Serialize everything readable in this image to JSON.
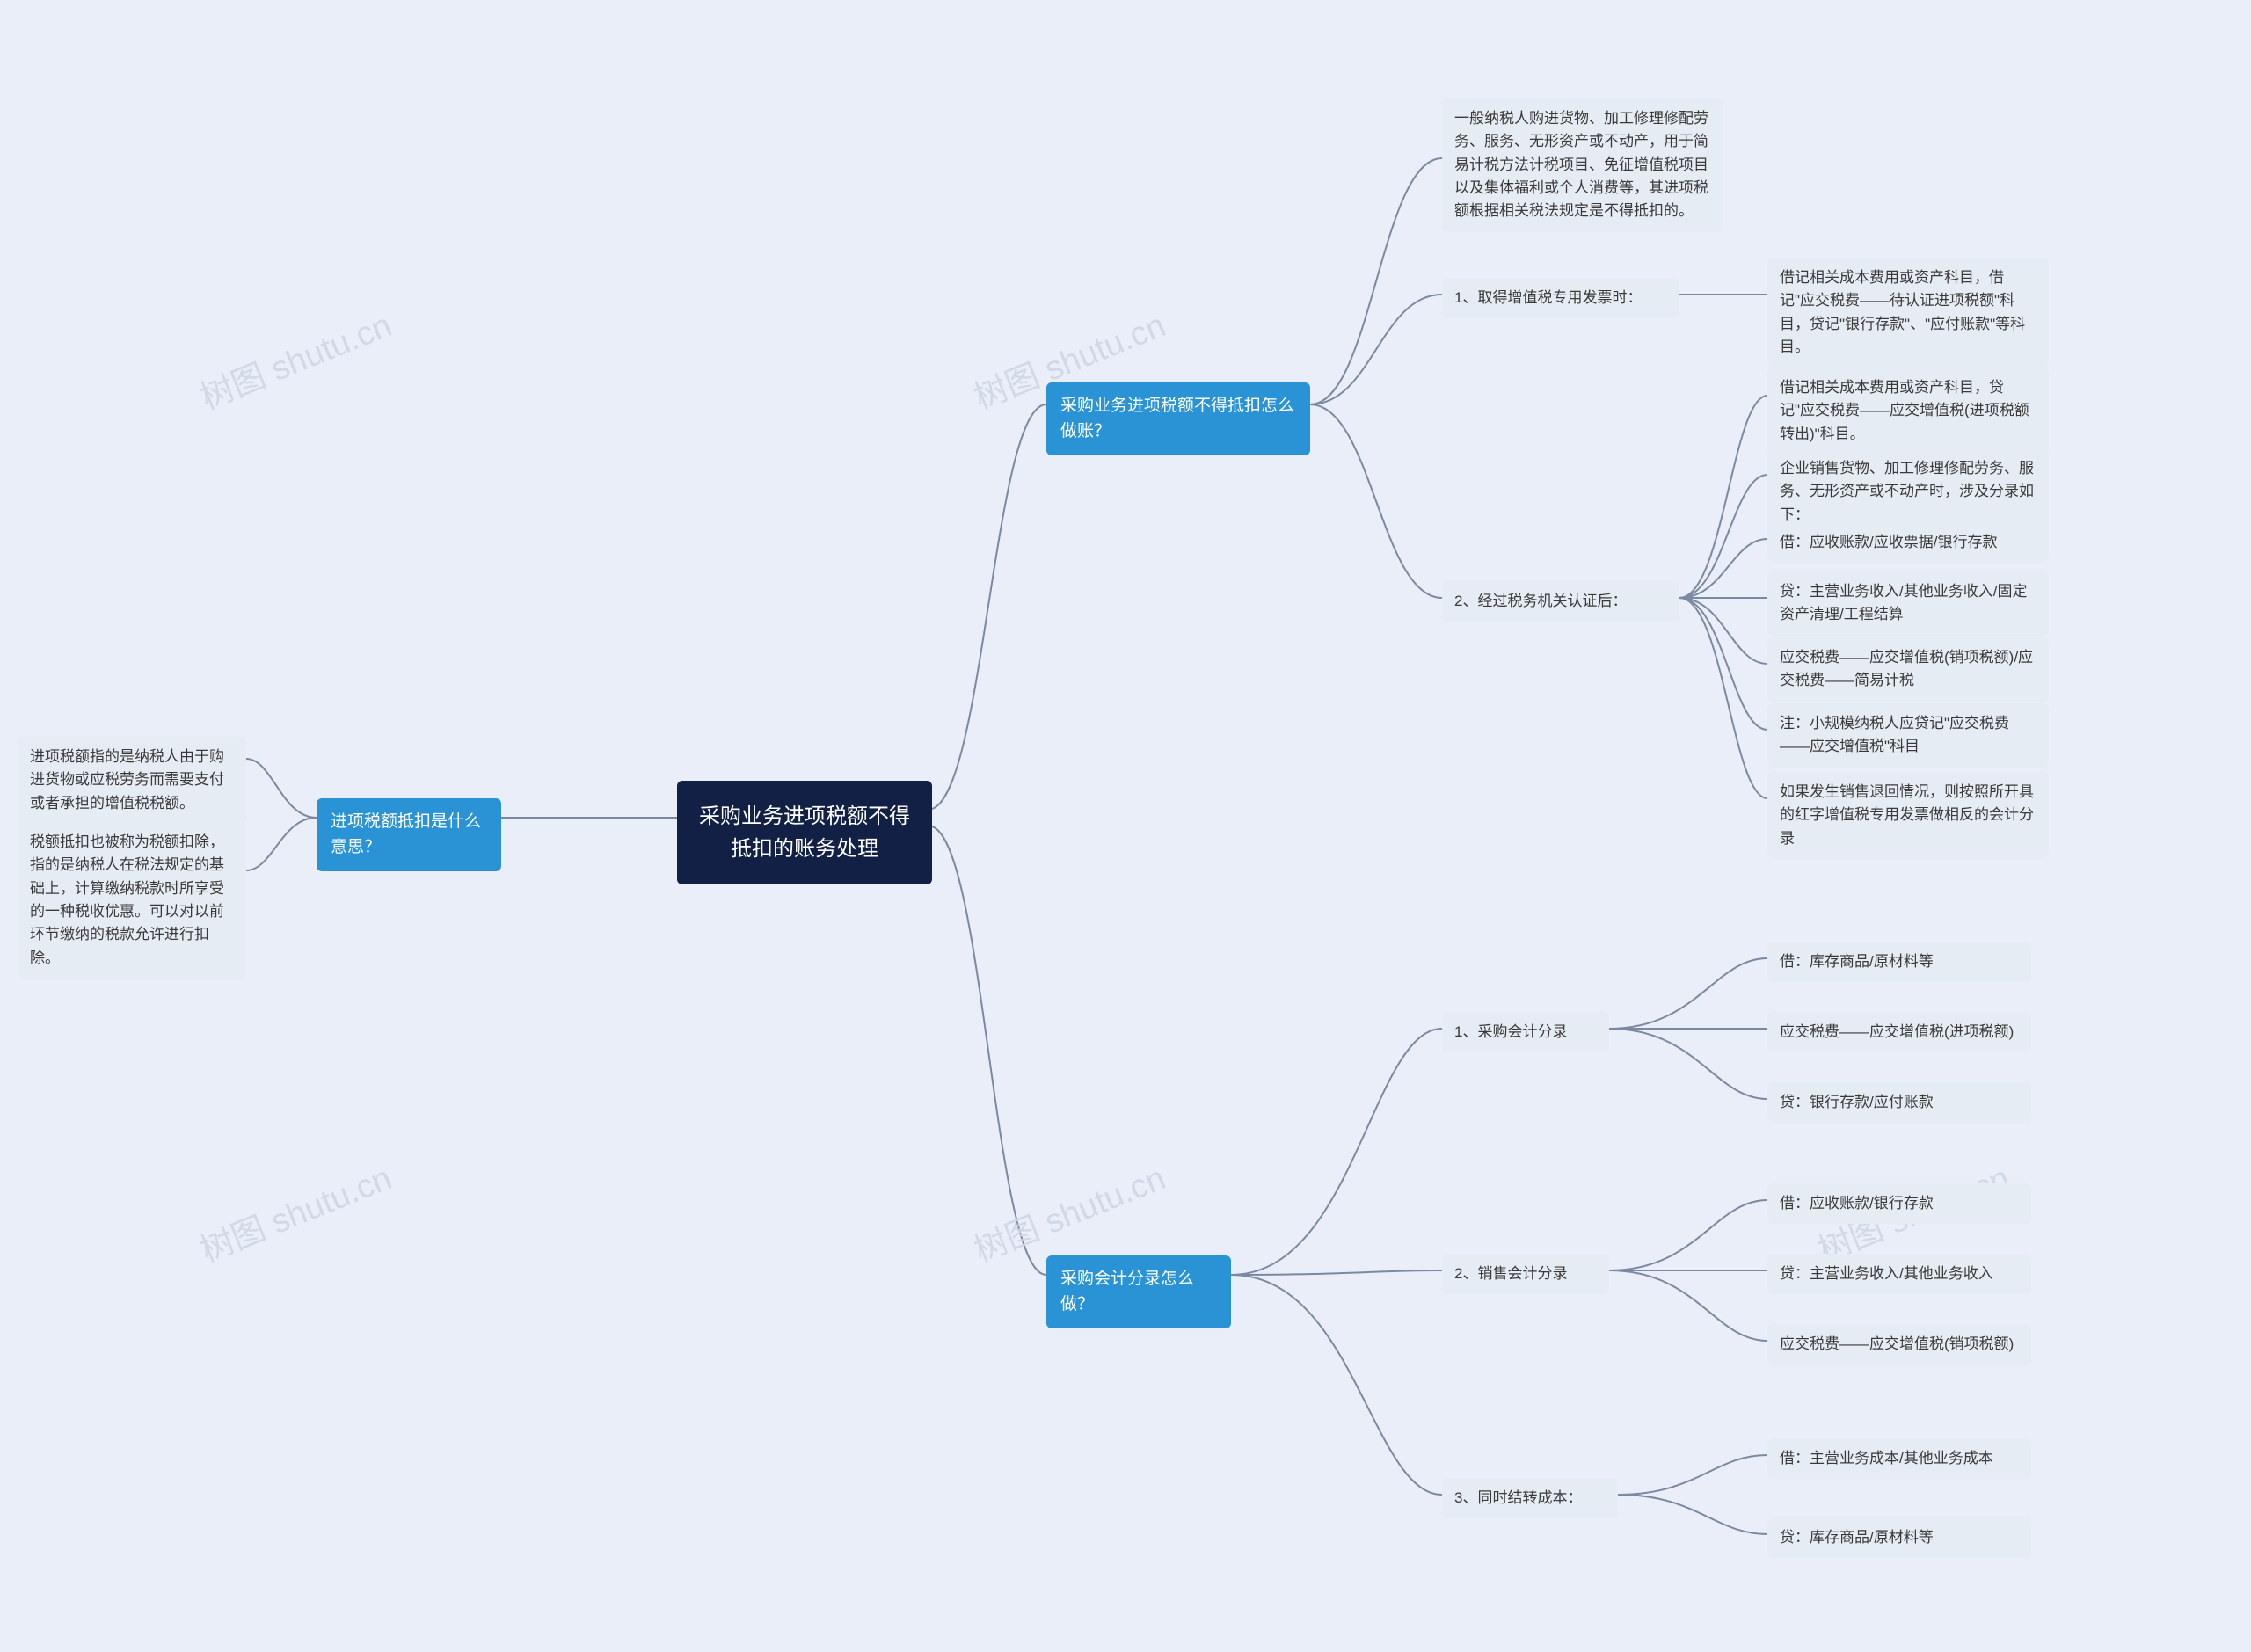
{
  "watermark": "树图 shutu.cn",
  "root": "采购业务进项税额不得抵扣的账务处理",
  "branches": {
    "leftBranch": "进项税额抵扣是什么意思？",
    "rightBranch1": "采购业务进项税额不得抵扣怎么做账？",
    "rightBranch2": "采购会计分录怎么做？"
  },
  "left": {
    "leaf1": "进项税额指的是纳税人由于购进货物或应税劳务而需要支付或者承担的增值税税额。",
    "leaf2": "税额抵扣也被称为税额扣除，指的是纳税人在税法规定的基础上，计算缴纳税款时所享受的一种税收优惠。可以对以前环节缴纳的税款允许进行扣除。"
  },
  "r1": {
    "intro": "一般纳税人购进货物、加工修理修配劳务、服务、无形资产或不动产，用于简易计税方法计税项目、免征增值税项目以及集体福利或个人消费等，其进项税额根据相关税法规定是不得抵扣的。",
    "step1Label": "1、取得增值税专用发票时：",
    "step1a": "借记相关成本费用或资产科目，借记\"应交税费——待认证进项税额\"科目，贷记\"银行存款\"、\"应付账款\"等科目。",
    "step2Label": "2、经过税务机关认证后：",
    "s2a": "借记相关成本费用或资产科目，贷记\"应交税费——应交增值税(进项税额转出)\"科目。",
    "s2b": "企业销售货物、加工修理修配劳务、服务、无形资产或不动产时，涉及分录如下：",
    "s2c": "借：应收账款/应收票据/银行存款",
    "s2d": "贷：主营业务收入/其他业务收入/固定资产清理/工程结算",
    "s2e": "应交税费——应交增值税(销项税额)/应交税费——简易计税",
    "s2f": "注：小规模纳税人应贷记\"应交税费——应交增值税\"科目",
    "s2g": "如果发生销售退回情况，则按照所开具的红字增值税专用发票做相反的会计分录"
  },
  "r2": {
    "g1Label": "1、采购会计分录",
    "g1a": "借：库存商品/原材料等",
    "g1b": "应交税费——应交增值税(进项税额)",
    "g1c": "贷：银行存款/应付账款",
    "g2Label": "2、销售会计分录",
    "g2a": "借：应收账款/银行存款",
    "g2b": "贷：主营业务收入/其他业务收入",
    "g2c": "应交税费——应交增值税(销项税额)",
    "g3Label": "3、同时结转成本：",
    "g3a": "借：主营业务成本/其他业务成本",
    "g3b": "贷：库存商品/原材料等"
  },
  "chart_data": {
    "type": "mindmap",
    "title": "采购业务进项税额不得抵扣的账务处理",
    "children": [
      {
        "label": "进项税额抵扣是什么意思？",
        "side": "left",
        "children": [
          {
            "text": "进项税额指的是纳税人由于购进货物或应税劳务而需要支付或者承担的增值税税额。"
          },
          {
            "text": "税额抵扣也被称为税额扣除，指的是纳税人在税法规定的基础上，计算缴纳税款时所享受的一种税收优惠。可以对以前环节缴纳的税款允许进行扣除。"
          }
        ]
      },
      {
        "label": "采购业务进项税额不得抵扣怎么做账？",
        "side": "right",
        "children": [
          {
            "text": "一般纳税人购进货物、加工修理修配劳务、服务、无形资产或不动产，用于简易计税方法计税项目、免征增值税项目以及集体福利或个人消费等，其进项税额根据相关税法规定是不得抵扣的。"
          },
          {
            "label": "1、取得增值税专用发票时：",
            "children": [
              {
                "text": "借记相关成本费用或资产科目，借记\"应交税费——待认证进项税额\"科目，贷记\"银行存款\"、\"应付账款\"等科目。"
              }
            ]
          },
          {
            "label": "2、经过税务机关认证后：",
            "children": [
              {
                "text": "借记相关成本费用或资产科目，贷记\"应交税费——应交增值税(进项税额转出)\"科目。"
              },
              {
                "text": "企业销售货物、加工修理修配劳务、服务、无形资产或不动产时，涉及分录如下："
              },
              {
                "text": "借：应收账款/应收票据/银行存款"
              },
              {
                "text": "贷：主营业务收入/其他业务收入/固定资产清理/工程结算"
              },
              {
                "text": "应交税费——应交增值税(销项税额)/应交税费——简易计税"
              },
              {
                "text": "注：小规模纳税人应贷记\"应交税费——应交增值税\"科目"
              },
              {
                "text": "如果发生销售退回情况，则按照所开具的红字增值税专用发票做相反的会计分录"
              }
            ]
          }
        ]
      },
      {
        "label": "采购会计分录怎么做？",
        "side": "right",
        "children": [
          {
            "label": "1、采购会计分录",
            "children": [
              {
                "text": "借：库存商品/原材料等"
              },
              {
                "text": "应交税费——应交增值税(进项税额)"
              },
              {
                "text": "贷：银行存款/应付账款"
              }
            ]
          },
          {
            "label": "2、销售会计分录",
            "children": [
              {
                "text": "借：应收账款/银行存款"
              },
              {
                "text": "贷：主营业务收入/其他业务收入"
              },
              {
                "text": "应交税费——应交增值税(销项税额)"
              }
            ]
          },
          {
            "label": "3、同时结转成本：",
            "children": [
              {
                "text": "借：主营业务成本/其他业务成本"
              },
              {
                "text": "贷：库存商品/原材料等"
              }
            ]
          }
        ]
      }
    ]
  }
}
